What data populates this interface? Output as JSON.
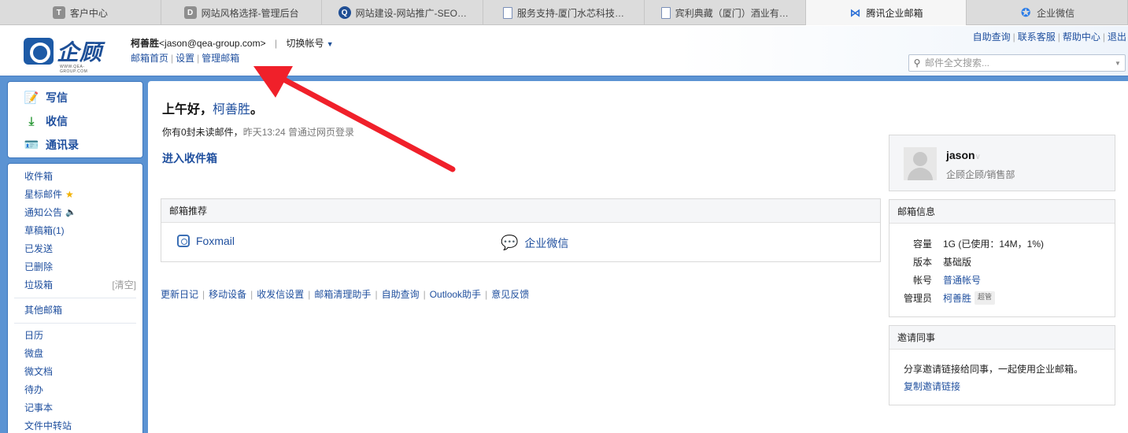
{
  "browser_tabs": [
    {
      "label": "客户中心",
      "icon": "T"
    },
    {
      "label": "网站风格选择-管理后台",
      "icon": "D"
    },
    {
      "label": "网站建设-网站推广-SEO…",
      "icon": "Q"
    },
    {
      "label": "服务支持-厦门水芯科技…",
      "icon": "doc"
    },
    {
      "label": "宾利典藏（厦门）酒业有…",
      "icon": "doc"
    },
    {
      "label": "腾讯企业邮箱",
      "icon": "bow",
      "active": true
    },
    {
      "label": "企业微信",
      "icon": "wx"
    }
  ],
  "header": {
    "logo_text": "企顾",
    "logo_sub": "WWW.QEA-GROUP.COM",
    "user_name": "柯善胜",
    "user_email": "<jason@qea-group.com>",
    "switch_account": "切换帐号",
    "subnav": [
      "邮箱首页",
      "设置",
      "管理邮箱"
    ],
    "toplinks": [
      "自助查询",
      "联系客服",
      "帮助中心",
      "退出"
    ],
    "search_placeholder": "邮件全文搜索..."
  },
  "sidebar": {
    "actions": [
      {
        "label": "写信",
        "icon": "compose-icon"
      },
      {
        "label": "收信",
        "icon": "receive-icon"
      },
      {
        "label": "通讯录",
        "icon": "contacts-icon"
      }
    ],
    "folders": {
      "inbox": "收件箱",
      "starred": "星标邮件",
      "notices": "通知公告",
      "drafts": "草稿箱(1)",
      "sent": "已发送",
      "deleted": "已删除",
      "spam": "垃圾箱",
      "spam_clear": "[清空]",
      "other": "其他邮箱",
      "calendar": "日历",
      "drive": "微盘",
      "docs": "微文档",
      "todo": "待办",
      "notes": "记事本",
      "transfer": "文件中转站"
    }
  },
  "main": {
    "greeting_prefix": "上午好，",
    "greeting_name": "柯善胜",
    "greeting_suffix": "。",
    "unread_text": "你有0封未读邮件，",
    "last_login": "昨天13:24 曾通过网页登录",
    "inbox_link": "进入收件箱",
    "recommend_title": "邮箱推荐",
    "recommend_apps": [
      "Foxmail",
      "企业微信"
    ],
    "footer_links": [
      "更新日记",
      "移动设备",
      "收发信设置",
      "邮箱清理助手",
      "自助查询",
      "Outlook助手",
      "意见反馈"
    ]
  },
  "profile": {
    "username": "jason",
    "dept": "企顾企顾/销售部"
  },
  "mailbox_info": {
    "title": "邮箱信息",
    "capacity_label": "容量",
    "capacity_value": "1G (已使用：14M，1%)",
    "version_label": "版本",
    "version_value": "基础版",
    "account_label": "帐号",
    "account_value": "普通帐号",
    "admin_label": "管理员",
    "admin_value": "柯善胜",
    "admin_badge": "超管"
  },
  "invite": {
    "title": "邀请同事",
    "text": "分享邀请链接给同事，一起使用企业邮箱。",
    "link": "复制邀请链接"
  },
  "annotation": {
    "arrow_color": "#f0202a"
  }
}
